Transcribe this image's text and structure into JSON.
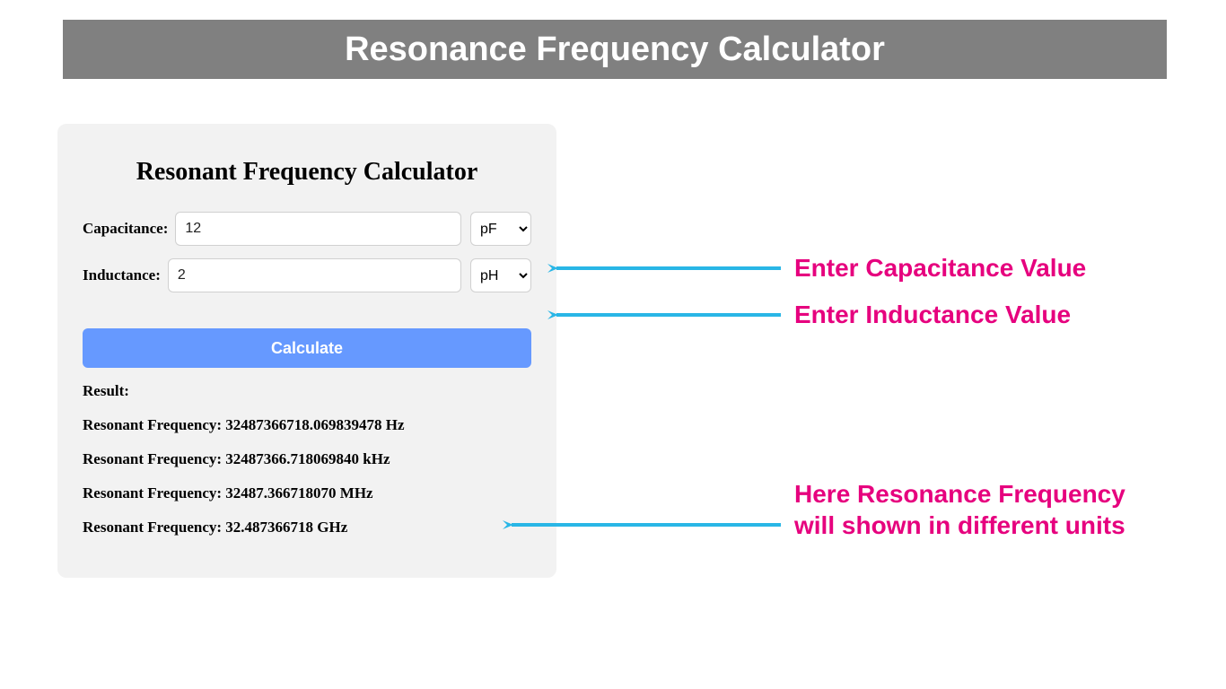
{
  "banner": {
    "title": "Resonance Frequency Calculator"
  },
  "card": {
    "title": "Resonant Frequency Calculator",
    "capacitance_label": "Capacitance:",
    "capacitance_value": "12",
    "capacitance_unit": "pF",
    "inductance_label": "Inductance:",
    "inductance_value": "2",
    "inductance_unit": "pH",
    "calculate_label": "Calculate",
    "result_heading": "Result:",
    "results": [
      "Resonant Frequency: 32487366718.069839478 Hz",
      "Resonant Frequency: 32487366.718069840 kHz",
      "Resonant Frequency: 32487.366718070 MHz",
      "Resonant Frequency: 32.487366718 GHz"
    ]
  },
  "annotations": {
    "cap_hint": "Enter Capacitance Value",
    "ind_hint": "Enter Inductance Value",
    "result_hint": "Here Resonance Frequency will shown in different units"
  },
  "colors": {
    "arrow": "#29b6e6",
    "annot_text": "#e6007e",
    "banner_bg": "#808080",
    "button_bg": "#6699ff"
  }
}
